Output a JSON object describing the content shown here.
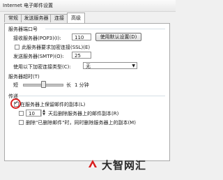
{
  "window": {
    "title": "Internet 电子邮件设置"
  },
  "tabs": [
    {
      "label": "常规"
    },
    {
      "label": "发送服务器"
    },
    {
      "label": "连接"
    },
    {
      "label": "高级"
    }
  ],
  "server_ports": {
    "group_title": "服务器端口号",
    "incoming_label": "接收服务器(POP3)(I):",
    "incoming_value": "110",
    "default_button": "使用默认设置(D)",
    "ssl_label": "此服务器要求加密连接(SSL)(E)",
    "ssl_checked": false,
    "outgoing_label": "发送服务器(SMTP)(O):",
    "outgoing_value": "25",
    "encryption_label": "使用以下加密连接类型(C):",
    "encryption_value": "无"
  },
  "timeout": {
    "group_title": "服务器超时(T)",
    "short_label": "短",
    "long_label": "长",
    "duration_text": "1 分钟",
    "level": 0.5
  },
  "delivery": {
    "group_title": "传递",
    "leave_copy_label": "在服务器上保留邮件的副本(L)",
    "leave_copy_checked": true,
    "remove_after_days_value": "10",
    "remove_after_label": "天后删除服务器上的邮件副本(R)",
    "remove_after_checked": false,
    "remove_deleted_label": "删除\"已删除邮件\"时，同时删除服务器上的副本(M)",
    "remove_deleted_checked": false
  },
  "watermark": {
    "text": "大智网汇"
  },
  "colors": {
    "highlight_circle": "#d81e1e",
    "panel_bg": "#ffffff",
    "dialog_bg": "#f0f0f0"
  }
}
